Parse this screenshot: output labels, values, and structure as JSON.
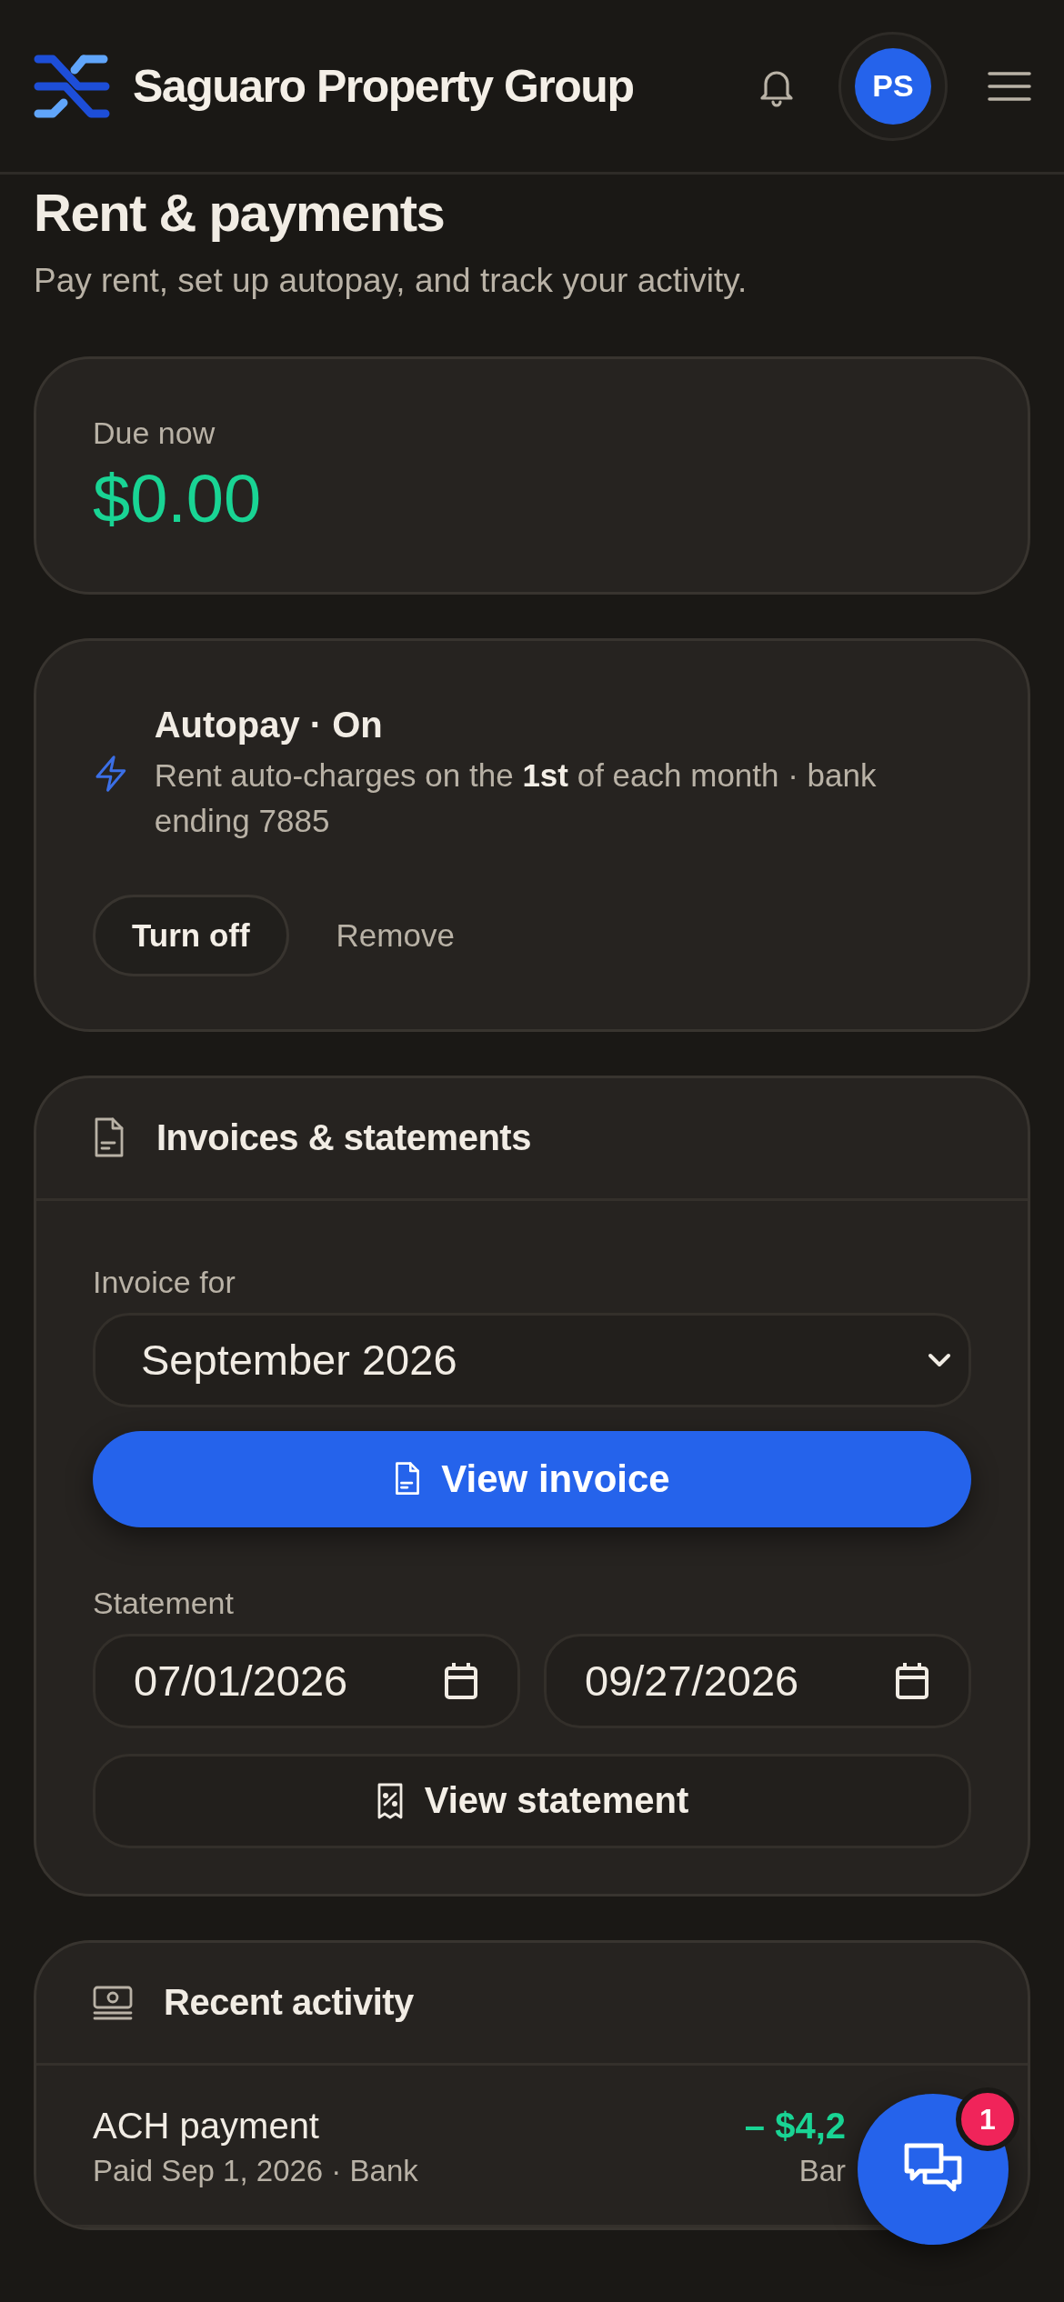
{
  "header": {
    "brand": "Saguaro Property Group",
    "avatar_initials": "PS"
  },
  "page": {
    "title": "Rent & payments",
    "subtitle": "Pay rent, set up autopay, and track your activity."
  },
  "due": {
    "label": "Due now",
    "amount": "$0.00"
  },
  "autopay": {
    "title": "Autopay · On",
    "description": "Rent auto-charges on the **1st** of each month · bank ending 7885",
    "buttons": [
      {
        "label": "Turn off",
        "kind": "outline"
      },
      {
        "label": "Remove",
        "kind": "text"
      }
    ]
  },
  "invoices": {
    "title": "Invoices & statements",
    "invoice_label": "Invoice for",
    "invoice_month": "September 2026",
    "view_invoice": "View invoice",
    "statement_label": "Statement",
    "start_date": "07/01/2026",
    "end_date": "09/27/2026",
    "view_statement": "View statement"
  },
  "activity": {
    "title": "Recent activity",
    "items": [
      {
        "name": "ACH payment",
        "detail": "Paid Sep 1, 2026  · Bank",
        "amount": "– $4,2",
        "method": "Bar"
      }
    ]
  },
  "chat": {
    "badge": "1"
  }
}
